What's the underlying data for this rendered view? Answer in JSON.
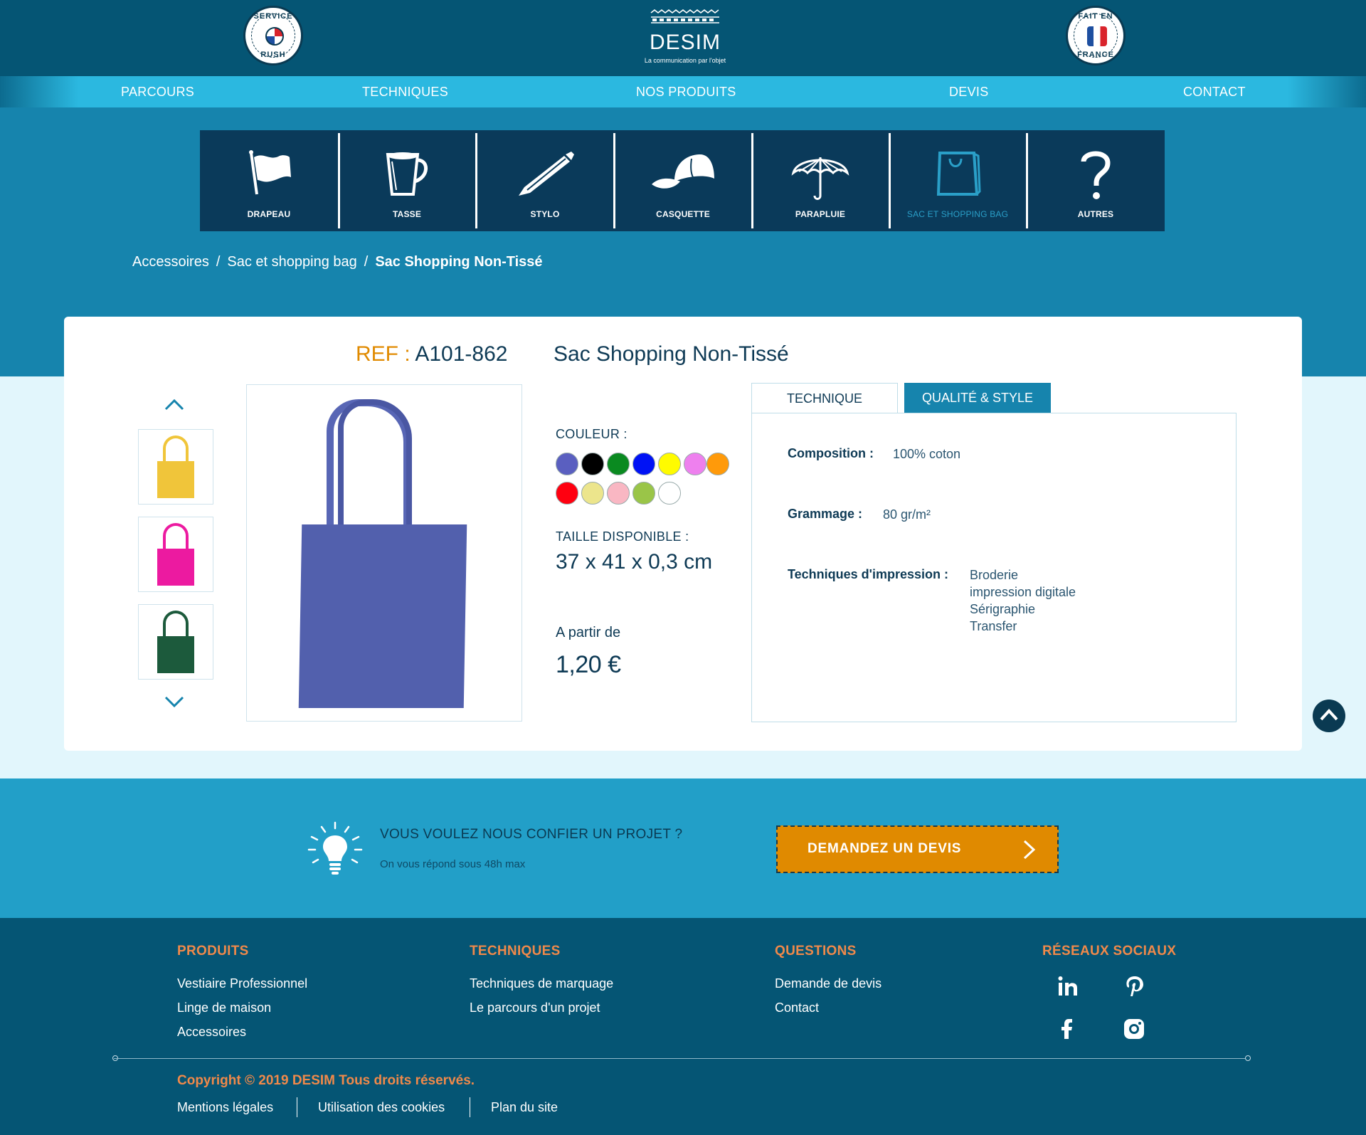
{
  "header": {
    "badge_left": {
      "top": "SERVICE",
      "bottom": "RUSH"
    },
    "badge_right": {
      "top": "FAIT EN",
      "bottom": "FRANCE"
    },
    "logo": {
      "name": "DESIM",
      "tagline": "La communication par l'objet"
    }
  },
  "nav": [
    "PARCOURS",
    "TECHNIQUES",
    "NOS PRODUITS",
    "DEVIS",
    "CONTACT"
  ],
  "categories": [
    {
      "label": "DRAPEAU",
      "icon": "flag-icon"
    },
    {
      "label": "TASSE",
      "icon": "mug-icon"
    },
    {
      "label": "STYLO",
      "icon": "pen-icon"
    },
    {
      "label": "CASQUETTE",
      "icon": "cap-icon"
    },
    {
      "label": "PARAPLUIE",
      "icon": "umbrella-icon"
    },
    {
      "label": "SAC ET SHOPPING BAG",
      "icon": "shopping-bag-icon",
      "active": true
    },
    {
      "label": "AUTRES",
      "icon": "question-icon"
    }
  ],
  "breadcrumb": [
    "Accessoires",
    "Sac et shopping bag",
    "Sac Shopping Non-Tissé"
  ],
  "product": {
    "ref_label": "REF :",
    "ref": "A101-862",
    "title": "Sac Shopping Non-Tissé",
    "thumbnails": [
      "#f0c53a",
      "#ec1aa0",
      "#1c5a3c"
    ],
    "main_color": "#5260ad",
    "color_label": "COULEUR :",
    "colors": [
      "#5a5fc0",
      "#000000",
      "#0a8a20",
      "#0012f5",
      "#fffb00",
      "#ee80ee",
      "#ff9a0a",
      "#ff0010",
      "#ece58c",
      "#f9b7c3",
      "#9ac548",
      "#ffffff"
    ],
    "size_label": "TAILLE DISPONIBLE :",
    "size": "37 x 41 x 0,3 cm",
    "price_from": "A partir de",
    "price": "1,20 €"
  },
  "tabs": {
    "technique": "TECHNIQUE",
    "quality": "QUALITÉ & STYLE"
  },
  "specs": {
    "composition_label": "Composition :",
    "composition": "100% coton",
    "grammage_label": "Grammage :",
    "grammage": "80 gr/m²",
    "techniques_label": "Techniques d'impression :",
    "techniques": [
      "Broderie",
      "impression digitale",
      "Sérigraphie",
      "Transfer"
    ]
  },
  "cta": {
    "question": "VOUS VOULEZ NOUS CONFIER UN PROJET ?",
    "subtitle": "On vous répond sous 48h max",
    "button": "DEMANDEZ UN DEVIS"
  },
  "footer": {
    "produits": {
      "title": "PRODUITS",
      "links": [
        "Vestiaire Professionnel",
        "Linge de maison",
        "Accessoires"
      ]
    },
    "techniques": {
      "title": "TECHNIQUES",
      "links": [
        "Techniques de marquage",
        "Le parcours d'un projet"
      ]
    },
    "questions": {
      "title": "QUESTIONS",
      "links": [
        "Demande de devis",
        "Contact"
      ]
    },
    "social": {
      "title": "RÉSEAUX SOCIAUX"
    },
    "copyright": "Copyright © 2019 DESIM Tous droits réservés.",
    "legal": [
      "Mentions légales",
      "Utilisation des cookies",
      "Plan du site"
    ]
  },
  "colors": {
    "accent": "#e08a00",
    "header": "#055574",
    "nav": "#2bb8e0",
    "band": "#1684ad"
  }
}
